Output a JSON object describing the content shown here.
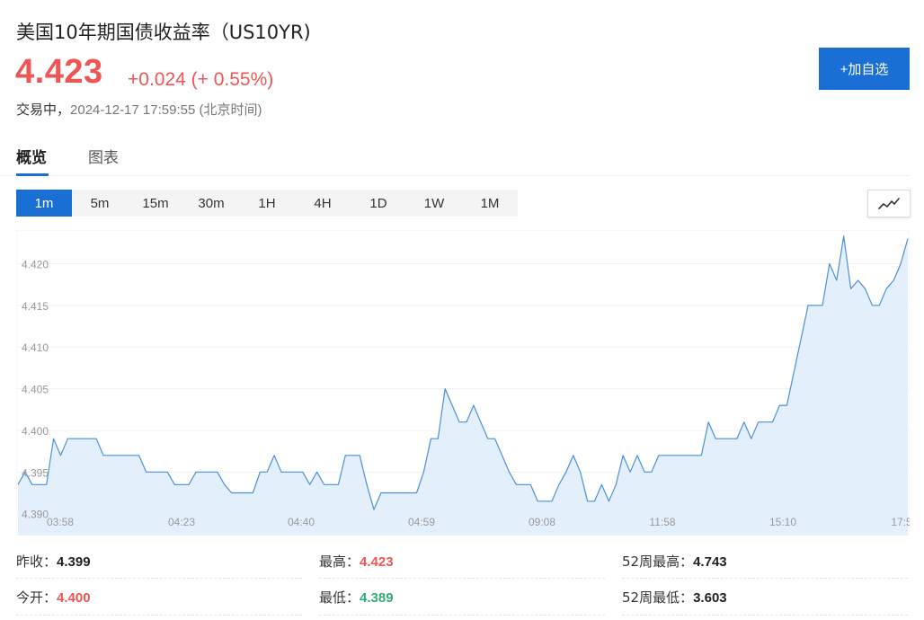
{
  "header": {
    "title": "美国10年期国债收益率（US10YR)",
    "price": "4.423",
    "change": "+0.024 (+ 0.55%)",
    "status_label": "交易中，",
    "timestamp": "2024-12-17 17:59:55 (北京时间)",
    "add_button": "+加自选"
  },
  "tabs": [
    {
      "label": "概览",
      "active": true
    },
    {
      "label": "图表",
      "active": false
    }
  ],
  "periods": [
    "1m",
    "5m",
    "15m",
    "30m",
    "1H",
    "4H",
    "1D",
    "1W",
    "1M"
  ],
  "active_period": "1m",
  "chart_toggle_icon": "line-chart-icon",
  "colors": {
    "up": "#ee5555",
    "down": "#33aa77",
    "accent": "#1a6fd4",
    "line": "#4a90d9",
    "fill": "#deedfb"
  },
  "chart_data": {
    "type": "area",
    "ylim": [
      4.389,
      4.4235
    ],
    "yticks": [
      "4.390",
      "4.395",
      "4.400",
      "4.405",
      "4.410",
      "4.415",
      "4.420"
    ],
    "xtick_labels": [
      "03:58",
      "04:23",
      "04:40",
      "04:59",
      "09:08",
      "11:58",
      "15:10",
      "17:5"
    ],
    "grid": true,
    "series": [
      {
        "values": [
          4.3935,
          4.395,
          4.3935,
          4.3935,
          4.3935,
          4.399,
          4.397,
          4.399,
          4.399,
          4.399,
          4.399,
          4.399,
          4.397,
          4.397,
          4.397,
          4.397,
          4.397,
          4.397,
          4.395,
          4.395,
          4.395,
          4.395,
          4.3935,
          4.3935,
          4.3935,
          4.395,
          4.395,
          4.395,
          4.395,
          4.3935,
          4.3925,
          4.3925,
          4.3925,
          4.3925,
          4.395,
          4.395,
          4.397,
          4.395,
          4.395,
          4.395,
          4.395,
          4.3935,
          4.395,
          4.3935,
          4.3935,
          4.3935,
          4.397,
          4.397,
          4.397,
          4.3935,
          4.3905,
          4.3925,
          4.3925,
          4.3925,
          4.3925,
          4.3925,
          4.3925,
          4.395,
          4.399,
          4.399,
          4.405,
          4.403,
          4.401,
          4.401,
          4.403,
          4.401,
          4.399,
          4.399,
          4.397,
          4.395,
          4.3935,
          4.3935,
          4.3935,
          4.3915,
          4.3915,
          4.3915,
          4.3935,
          4.395,
          4.397,
          4.395,
          4.3915,
          4.3915,
          4.3935,
          4.3915,
          4.3935,
          4.397,
          4.395,
          4.397,
          4.395,
          4.395,
          4.397,
          4.397,
          4.397,
          4.397,
          4.397,
          4.397,
          4.397,
          4.401,
          4.399,
          4.399,
          4.399,
          4.399,
          4.401,
          4.399,
          4.401,
          4.401,
          4.401,
          4.403,
          4.403,
          4.407,
          4.411,
          4.415,
          4.415,
          4.415,
          4.42,
          4.418,
          4.4233,
          4.417,
          4.418,
          4.417,
          4.415,
          4.415,
          4.417,
          4.418,
          4.42,
          4.423
        ]
      }
    ]
  },
  "stats": {
    "prev_close_label": "昨收：",
    "prev_close": "4.399",
    "high_label": "最高：",
    "high": "4.423",
    "high52_label": "52周最高：",
    "high52": "4.743",
    "open_label": "今开：",
    "open": "4.400",
    "low_label": "最低：",
    "low": "4.389",
    "low52_label": "52周最低：",
    "low52": "3.603"
  }
}
